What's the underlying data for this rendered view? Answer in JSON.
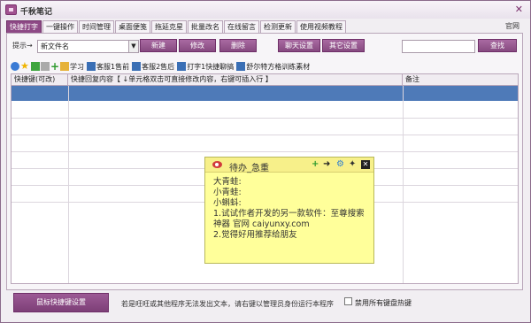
{
  "window": {
    "title": "千秋笔记",
    "official_link": "官网"
  },
  "tabs": [
    {
      "label": "快捷打字",
      "active": true
    },
    {
      "label": "一键操作"
    },
    {
      "label": "时间管理"
    },
    {
      "label": "桌面便笺"
    },
    {
      "label": "拖延克星"
    },
    {
      "label": "批量改名"
    },
    {
      "label": "在线留言"
    },
    {
      "label": "检测更新"
    },
    {
      "label": "使用视频教程"
    }
  ],
  "controls": {
    "prompt_label": "提示→",
    "file_select_value": "新文件名",
    "new_btn": "新建",
    "edit_btn": "修改",
    "delete_btn": "删除",
    "chat_settings_btn": "聊天设置",
    "other_settings_btn": "其它设置",
    "search_btn": "查找"
  },
  "toolbar": {
    "items": [
      "学习",
      "客服1售前",
      "客服2售后",
      "打字1快捷聊搞",
      "舒尔特方格训练素材"
    ],
    "icons": [
      "globe-icon",
      "star-icon",
      "arrow-left-icon",
      "arrow-right-icon",
      "add-icon",
      "folder-icon"
    ]
  },
  "table": {
    "headers": [
      "快捷键(可改)",
      "快捷回复内容【 ↓单元格双击可直接修改内容，右键可插入行 】",
      "备注"
    ]
  },
  "note": {
    "title": "待办_急重",
    "lines": [
      "大青蛙:",
      "小青蛙:",
      "小蝌蚪:",
      "1.试试作者开发的另一款软件：至尊搜索神器 官网 caiyunxy.com",
      "2.觉得好用推荐给朋友"
    ]
  },
  "footer": {
    "mouse_btn": "鼠标快捷键设置",
    "hint": "若是旺旺或其他程序无法发出文本，请右键以管理员身份运行本程序",
    "disable_label": "禁用所有键盘热键"
  },
  "colors": {
    "accent": "#8e4a86",
    "selected_row": "#4e7ab8",
    "note_bg": "#ffff9a"
  }
}
